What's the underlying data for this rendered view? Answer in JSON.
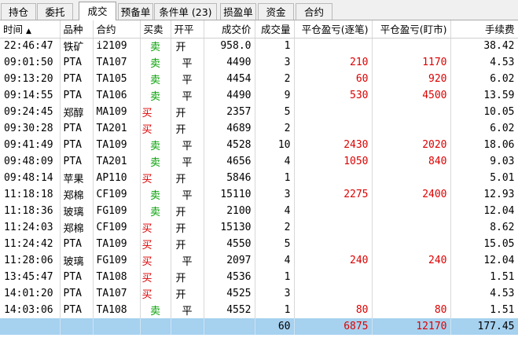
{
  "tabs": [
    {
      "label": "持仓"
    },
    {
      "label": "委托"
    },
    {
      "label": "成交"
    },
    {
      "label": "预备单"
    },
    {
      "label": "条件单 (23)"
    },
    {
      "label": "损盈单"
    },
    {
      "label": "资金"
    },
    {
      "label": "合约"
    }
  ],
  "active_tab": "成交",
  "columns": {
    "time": "时间",
    "product": "品种",
    "contract": "合约",
    "side": "买卖",
    "offset": "开平",
    "price": "成交价",
    "qty": "成交量",
    "pnl_close": "平仓盈亏(逐笔)",
    "pnl_mtm": "平仓盈亏(盯市)",
    "fee": "手续费"
  },
  "sort_indicator": "▲",
  "rows": [
    {
      "time": "22:46:47",
      "product": "铁矿",
      "contract": "i2109",
      "side": "卖",
      "offset": "开",
      "price": "958.0",
      "qty": "1",
      "pnl_close": "",
      "pnl_mtm": "",
      "fee": "38.42"
    },
    {
      "time": "09:01:50",
      "product": "PTA",
      "contract": "TA107",
      "side": "卖",
      "offset": "平",
      "price": "4490",
      "qty": "3",
      "pnl_close": "210",
      "pnl_mtm": "1170",
      "fee": "4.53"
    },
    {
      "time": "09:13:20",
      "product": "PTA",
      "contract": "TA105",
      "side": "卖",
      "offset": "平",
      "price": "4454",
      "qty": "2",
      "pnl_close": "60",
      "pnl_mtm": "920",
      "fee": "6.02"
    },
    {
      "time": "09:14:55",
      "product": "PTA",
      "contract": "TA106",
      "side": "卖",
      "offset": "平",
      "price": "4490",
      "qty": "9",
      "pnl_close": "530",
      "pnl_mtm": "4500",
      "fee": "13.59"
    },
    {
      "time": "09:24:45",
      "product": "郑醇",
      "contract": "MA109",
      "side": "买",
      "offset": "开",
      "price": "2357",
      "qty": "5",
      "pnl_close": "",
      "pnl_mtm": "",
      "fee": "10.05"
    },
    {
      "time": "09:30:28",
      "product": "PTA",
      "contract": "TA201",
      "side": "买",
      "offset": "开",
      "price": "4689",
      "qty": "2",
      "pnl_close": "",
      "pnl_mtm": "",
      "fee": "6.02"
    },
    {
      "time": "09:41:49",
      "product": "PTA",
      "contract": "TA109",
      "side": "卖",
      "offset": "平",
      "price": "4528",
      "qty": "10",
      "pnl_close": "2430",
      "pnl_mtm": "2020",
      "fee": "18.06"
    },
    {
      "time": "09:48:09",
      "product": "PTA",
      "contract": "TA201",
      "side": "卖",
      "offset": "平",
      "price": "4656",
      "qty": "4",
      "pnl_close": "1050",
      "pnl_mtm": "840",
      "fee": "9.03"
    },
    {
      "time": "09:48:14",
      "product": "苹果",
      "contract": "AP110",
      "side": "买",
      "offset": "开",
      "price": "5846",
      "qty": "1",
      "pnl_close": "",
      "pnl_mtm": "",
      "fee": "5.01"
    },
    {
      "time": "11:18:18",
      "product": "郑棉",
      "contract": "CF109",
      "side": "卖",
      "offset": "平",
      "price": "15110",
      "qty": "3",
      "pnl_close": "2275",
      "pnl_mtm": "2400",
      "fee": "12.93"
    },
    {
      "time": "11:18:36",
      "product": "玻璃",
      "contract": "FG109",
      "side": "卖",
      "offset": "开",
      "price": "2100",
      "qty": "4",
      "pnl_close": "",
      "pnl_mtm": "",
      "fee": "12.04"
    },
    {
      "time": "11:24:03",
      "product": "郑棉",
      "contract": "CF109",
      "side": "买",
      "offset": "开",
      "price": "15130",
      "qty": "2",
      "pnl_close": "",
      "pnl_mtm": "",
      "fee": "8.62"
    },
    {
      "time": "11:24:42",
      "product": "PTA",
      "contract": "TA109",
      "side": "买",
      "offset": "开",
      "price": "4550",
      "qty": "5",
      "pnl_close": "",
      "pnl_mtm": "",
      "fee": "15.05"
    },
    {
      "time": "11:28:06",
      "product": "玻璃",
      "contract": "FG109",
      "side": "买",
      "offset": "平",
      "price": "2097",
      "qty": "4",
      "pnl_close": "240",
      "pnl_mtm": "240",
      "fee": "12.04"
    },
    {
      "time": "13:45:47",
      "product": "PTA",
      "contract": "TA108",
      "side": "买",
      "offset": "开",
      "price": "4536",
      "qty": "1",
      "pnl_close": "",
      "pnl_mtm": "",
      "fee": "1.51"
    },
    {
      "time": "14:01:20",
      "product": "PTA",
      "contract": "TA107",
      "side": "买",
      "offset": "开",
      "price": "4525",
      "qty": "3",
      "pnl_close": "",
      "pnl_mtm": "",
      "fee": "4.53"
    },
    {
      "time": "14:03:06",
      "product": "PTA",
      "contract": "TA108",
      "side": "卖",
      "offset": "平",
      "price": "4552",
      "qty": "1",
      "pnl_close": "80",
      "pnl_mtm": "80",
      "fee": "1.51"
    }
  ],
  "totals": {
    "qty": "60",
    "pnl_close": "6875",
    "pnl_mtm": "12170",
    "fee": "177.45"
  },
  "colors": {
    "buy": "#dd0000",
    "sell": "#00a000",
    "pnl": "#dd0000",
    "total_row": "#a6d1ef"
  }
}
